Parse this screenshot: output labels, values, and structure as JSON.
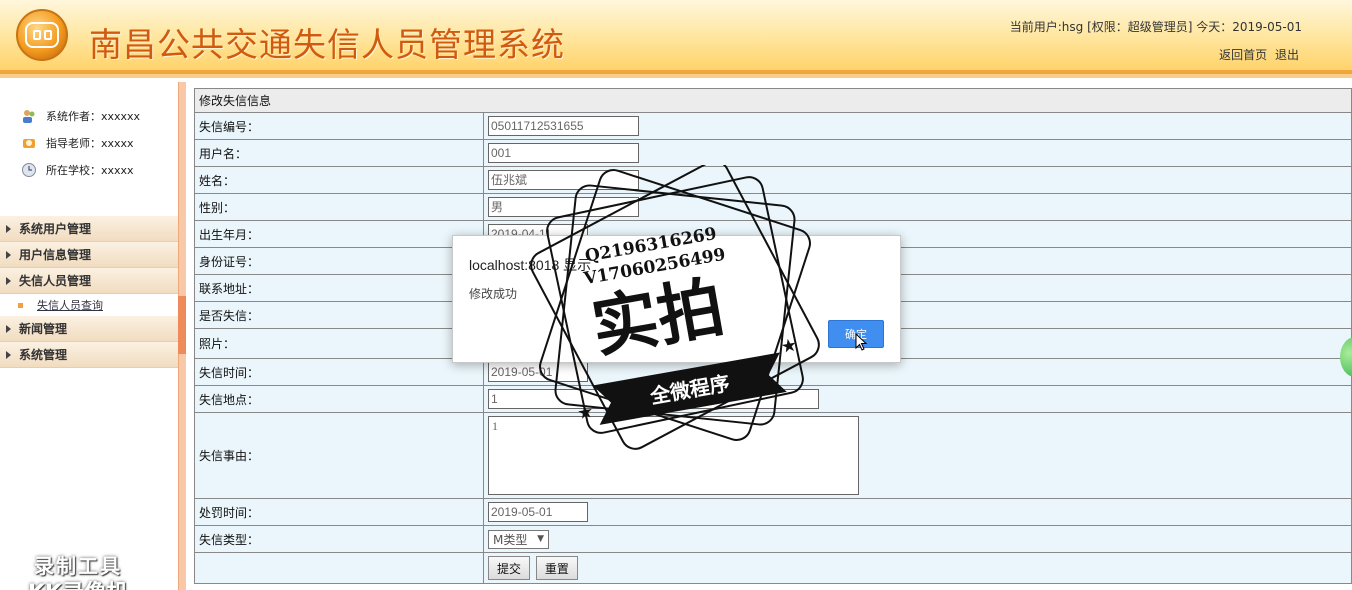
{
  "header": {
    "title": "南昌公共交通失信人员管理系统",
    "user_info": "当前用户:hsg [权限：超级管理员] 今天：2019-05-01",
    "links": [
      "返回首页",
      "退出"
    ]
  },
  "sidebar": {
    "info": [
      {
        "label": "系统作者：xxxxxx",
        "icon": "users-icon"
      },
      {
        "label": "指导老师：xxxxx",
        "icon": "teacher-icon"
      },
      {
        "label": "所在学校：xxxxx",
        "icon": "clock-icon"
      }
    ],
    "nav": [
      {
        "label": "系统用户管理"
      },
      {
        "label": "用户信息管理"
      },
      {
        "label": "失信人员管理",
        "children": [
          "失信人员查询"
        ]
      },
      {
        "label": "新闻管理"
      },
      {
        "label": "系统管理"
      }
    ],
    "watermark": [
      "录制工具",
      "KK录像机"
    ]
  },
  "form": {
    "heading": "修改失信信息",
    "labels": {
      "id": "失信编号：",
      "username": "用户名：",
      "name": "姓名：",
      "gender": "性别：",
      "birth": "出生年月：",
      "idcard": "身份证号：",
      "address": "联系地址：",
      "is_dishonest": "是否失信：",
      "photo": "照片：",
      "time": "失信时间：",
      "place": "失信地点：",
      "reason": "失信事由：",
      "penalty_time": "处罚时间：",
      "type": "失信类型："
    },
    "values": {
      "id": "05011712531655",
      "username": "001",
      "name": "伍兆斌",
      "gender": "男",
      "birth": "2019-04-11",
      "time": "2019-05-01",
      "place": "1",
      "reason": "1",
      "penalty_time": "2019-05-01",
      "type": "M类型"
    },
    "buttons": {
      "submit": "提交",
      "reset": "重置"
    }
  },
  "dialog": {
    "title": "localhost:8018 显示",
    "message": "修改成功",
    "ok": "确定"
  },
  "stamp": {
    "line1": "Q2196316269",
    "line2": "V17060256499",
    "main": "实拍",
    "ribbon": "全微程序"
  },
  "colors": {
    "title": "#d05b10",
    "header_border": "#f0a63a",
    "dialog_ok": "#3f8ef0",
    "form_bg": "#eaf6fb"
  }
}
